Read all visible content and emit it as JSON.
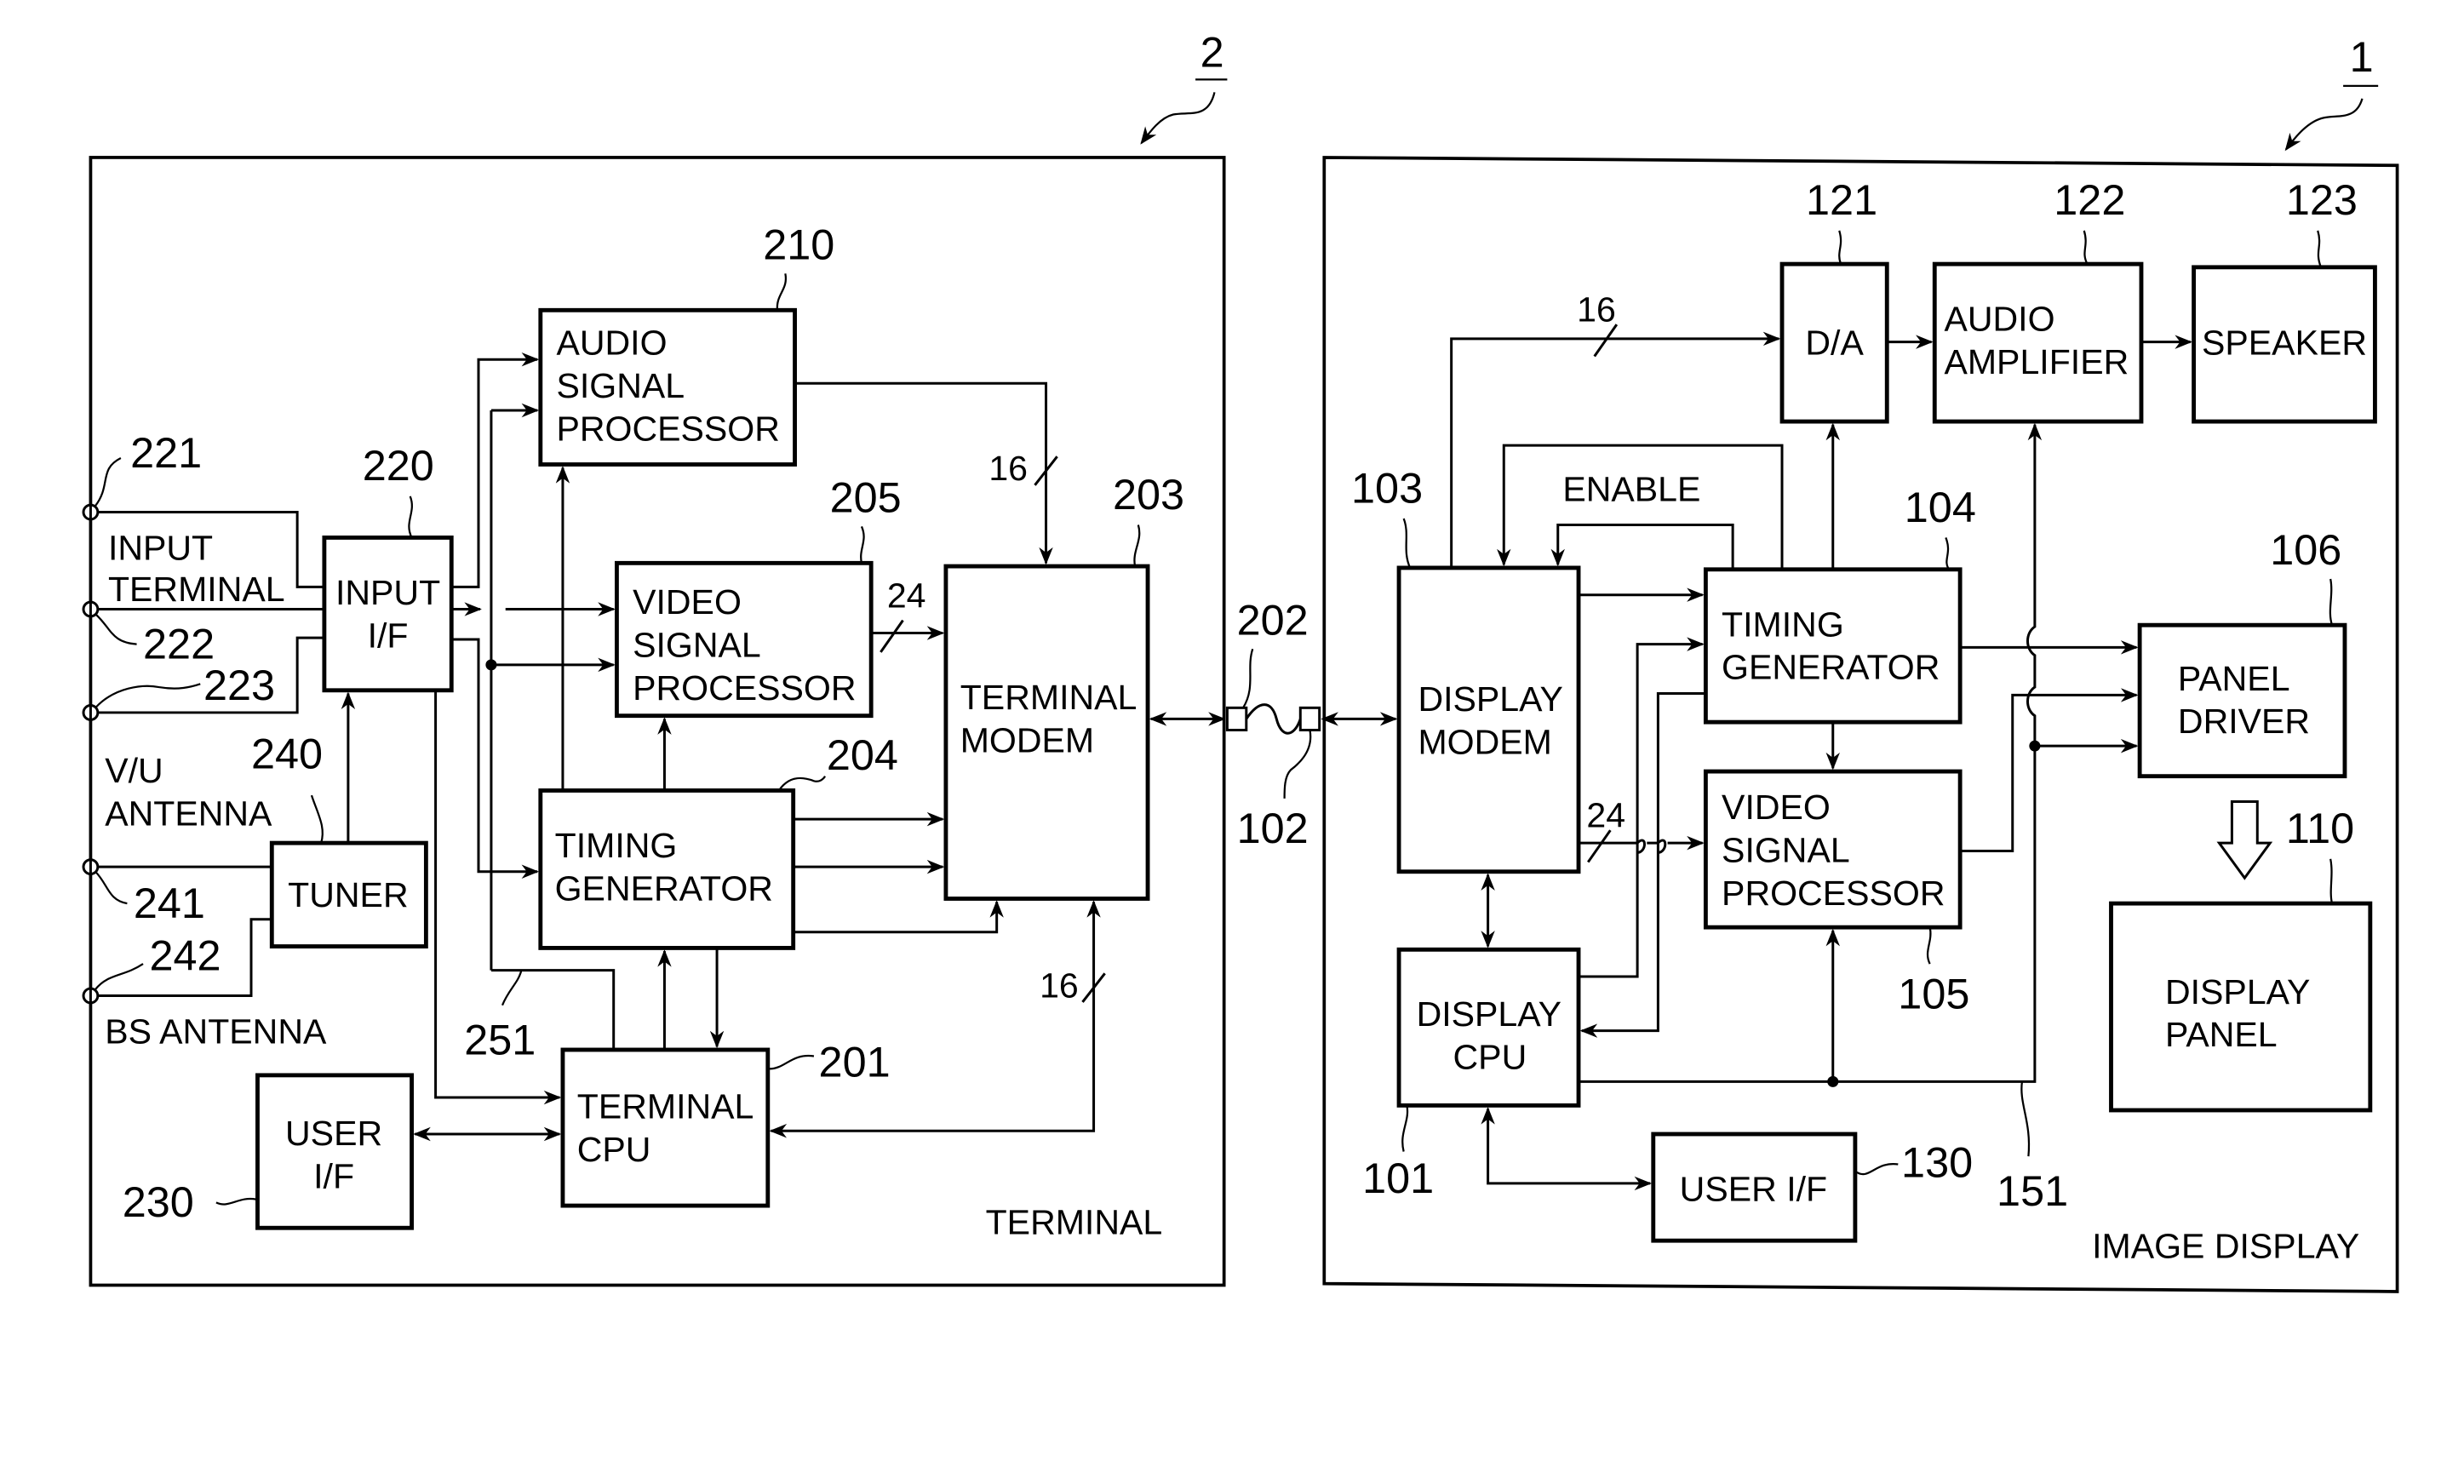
{
  "figure": {
    "systems": [
      {
        "id": "terminal",
        "ref": "2",
        "caption": "TERMINAL"
      },
      {
        "id": "image_display",
        "ref": "1",
        "caption": "IMAGE DISPLAY"
      }
    ],
    "terminal_blocks": {
      "audio_sp": {
        "ref": "210",
        "lines": [
          "AUDIO",
          "SIGNAL",
          "PROCESSOR"
        ]
      },
      "input_if": {
        "ref": "220",
        "lines": [
          "INPUT",
          "I/F"
        ]
      },
      "video_sp": {
        "ref": "205",
        "lines": [
          "VIDEO",
          "SIGNAL",
          "PROCESSOR"
        ]
      },
      "modem": {
        "ref": "203",
        "lines": [
          "TERMINAL",
          "MODEM"
        ]
      },
      "timing": {
        "ref": "204",
        "lines": [
          "TIMING",
          "GENERATOR"
        ]
      },
      "tuner": {
        "ref": "240",
        "lines": [
          "TUNER"
        ]
      },
      "cpu": {
        "ref": "201",
        "lines": [
          "TERMINAL",
          "CPU"
        ]
      },
      "user_if": {
        "ref": "230",
        "lines": [
          "USER",
          "I/F"
        ]
      }
    },
    "terminal_io": {
      "t221": "221",
      "t222": "222",
      "t223": "223",
      "input_terminal": [
        "INPUT",
        "TERMINAL"
      ],
      "vu_antenna": [
        "V/U",
        "ANTENNA"
      ],
      "t241": "241",
      "t242": "242",
      "bs_antenna": "BS  ANTENNA",
      "bus251": "251",
      "bus16_audio": "16",
      "bus24_video": "24",
      "bus16_cpu": "16"
    },
    "link": {
      "terminal_connector": "202",
      "display_connector": "102"
    },
    "display_blocks": {
      "modem": {
        "ref": "103",
        "lines": [
          "DISPLAY",
          "MODEM"
        ]
      },
      "da": {
        "ref": "121",
        "lines": [
          "D/A"
        ]
      },
      "amp": {
        "ref": "122",
        "lines": [
          "AUDIO",
          "AMPLIFIER"
        ]
      },
      "speaker": {
        "ref": "123",
        "lines": [
          "SPEAKER"
        ]
      },
      "timing": {
        "ref": "104",
        "lines": [
          "TIMING",
          "GENERATOR"
        ]
      },
      "video_sp": {
        "ref": "105",
        "lines": [
          "VIDEO",
          "SIGNAL",
          "PROCESSOR"
        ]
      },
      "panel_driver": {
        "ref": "106",
        "lines": [
          "PANEL",
          "DRIVER"
        ]
      },
      "panel": {
        "ref": "110",
        "lines": [
          "DISPLAY",
          "PANEL"
        ]
      },
      "cpu": {
        "ref": "101",
        "lines": [
          "DISPLAY",
          "CPU"
        ]
      },
      "user_if": {
        "ref": "130",
        "lines": [
          "USER  I/F"
        ]
      }
    },
    "display_io": {
      "enable": "ENABLE",
      "bus16": "16",
      "bus24": "24",
      "bus151": "151"
    }
  }
}
